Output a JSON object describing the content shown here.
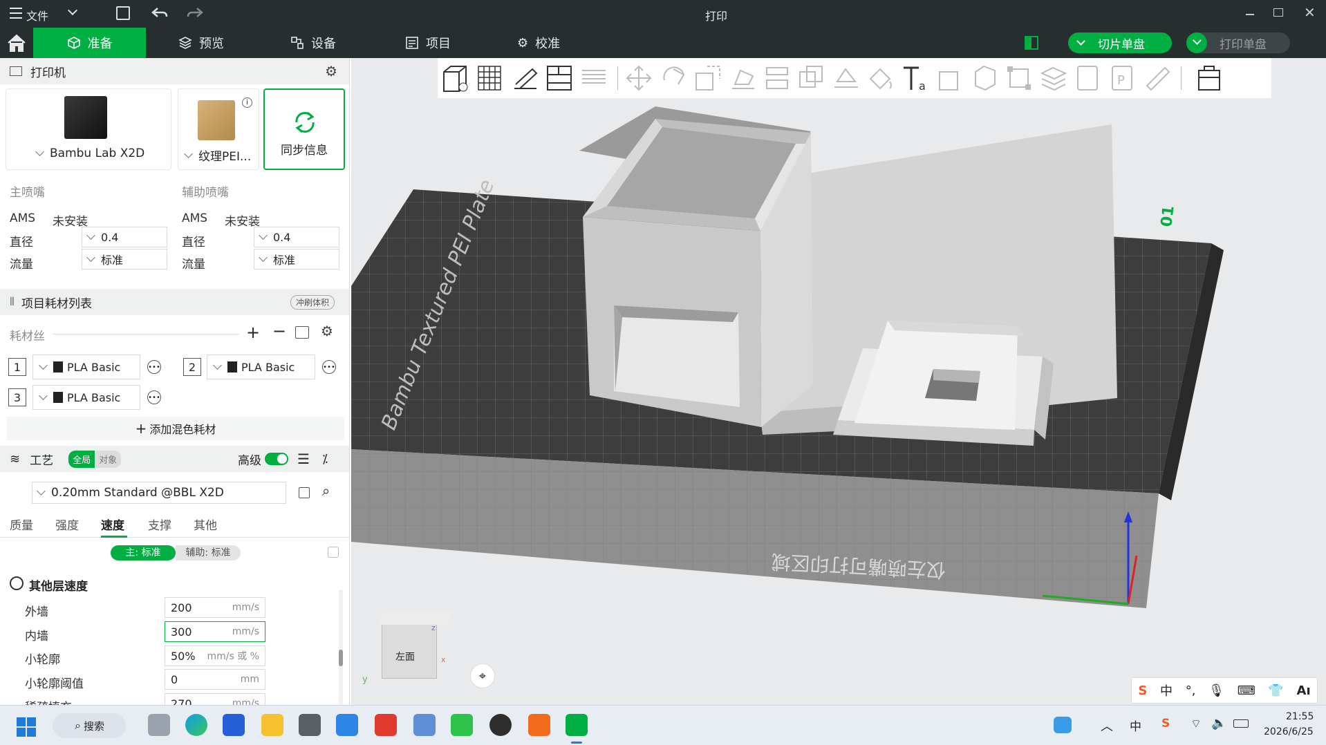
{
  "window": {
    "menu_label": "文件",
    "title": "打印"
  },
  "tabs": [
    {
      "label": "准备"
    },
    {
      "label": "预览"
    },
    {
      "label": "设备"
    },
    {
      "label": "项目"
    },
    {
      "label": "校准"
    }
  ],
  "actions": {
    "slice": "切片单盘",
    "print": "打印单盘"
  },
  "printer": {
    "section_title": "打印机",
    "model": "Bambu Lab X2D",
    "plate": "纹理PEI...",
    "sync": "同步信息"
  },
  "nozzles": {
    "main": {
      "title": "主喷嘴",
      "ams_label": "AMS",
      "ams_value": "未安装",
      "diameter_label": "直径",
      "diameter": "0.4",
      "flow_label": "流量",
      "flow": "标准"
    },
    "aux": {
      "title": "辅助喷嘴",
      "ams_label": "AMS",
      "ams_value": "未安装",
      "diameter_label": "直径",
      "diameter": "0.4",
      "flow_label": "流量",
      "flow": "标准"
    }
  },
  "filaments": {
    "section_title": "项目耗材列表",
    "flush_button": "冲刷体积",
    "row_label": "耗材丝",
    "items": [
      {
        "index": "1",
        "name": "PLA Basic"
      },
      {
        "index": "2",
        "name": "PLA Basic"
      },
      {
        "index": "3",
        "name": "PLA Basic"
      }
    ],
    "add_mixed": "添加混色耗材"
  },
  "process": {
    "section_title": "工艺",
    "global": "全局",
    "object": "对象",
    "advanced": "高级",
    "preset": "0.20mm Standard @BBL X2D",
    "subtabs": [
      "质量",
      "强度",
      "速度",
      "支撑",
      "其他"
    ],
    "main_mode": "主: 标准",
    "aux_mode": "辅助: 标准",
    "group_title": "其他层速度",
    "rows": [
      {
        "label": "外墙",
        "value": "200",
        "unit": "mm/s"
      },
      {
        "label": "内墙",
        "value": "300",
        "unit": "mm/s"
      },
      {
        "label": "小轮廓",
        "value": "50%",
        "unit": "mm/s 或 %"
      },
      {
        "label": "小轮廓阈值",
        "value": "0",
        "unit": "mm"
      },
      {
        "label": "稀疏填充",
        "value": "270",
        "unit": "mm/s"
      }
    ]
  },
  "viewport": {
    "plate_label": "Bambu Textured PEI Plate",
    "zone_text": "仅左喷嘴可打印区域",
    "plate_number": "01",
    "view_cube_label": "左面",
    "axis_z": "z",
    "axis_x": "x",
    "axis_y": "y"
  },
  "taskbar": {
    "search": "搜索",
    "ime_lang": "中",
    "time": "21:55",
    "date": "2026/6/25"
  },
  "colors": {
    "accent": "#00ae42",
    "titlebar": "#262e30",
    "viewport_bg": "#e9eaeb"
  }
}
